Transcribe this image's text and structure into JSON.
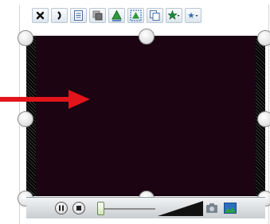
{
  "toolbar": {
    "buttons": [
      {
        "icon": "close-x-icon"
      },
      {
        "icon": "rotate-icon"
      },
      {
        "icon": "properties-icon"
      },
      {
        "icon": "layers-icon"
      },
      {
        "icon": "shape-up-icon"
      },
      {
        "icon": "shape-select-icon"
      },
      {
        "icon": "copy-icon"
      },
      {
        "icon": "star-dropdown-icon"
      },
      {
        "icon": "star-small-dropdown-icon"
      }
    ]
  },
  "video": {
    "background_color": "#1c0413"
  },
  "annotation": {
    "arrow_color": "#e3141a"
  },
  "controls": {
    "play_pause_icon": "pause-icon",
    "stop_icon": "stop-icon",
    "snapshot_icon": "camera-icon",
    "fullscreen_icon": "landscape-icon"
  }
}
